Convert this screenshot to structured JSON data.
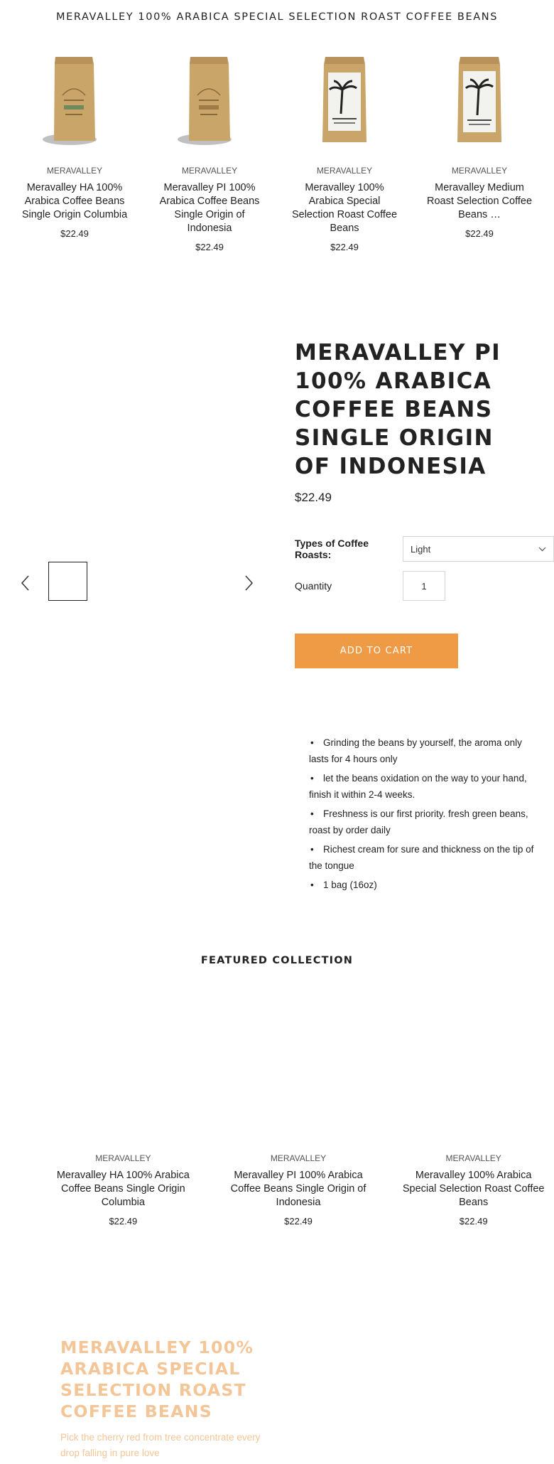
{
  "top_title": "MERAVALLEY 100% ARABICA SPECIAL SELECTION ROAST COFFEE BEANS",
  "related_products": [
    {
      "vendor": "MERAVALLEY",
      "title": "Meravalley HA 100% Arabica Coffee Beans Single Origin Columbia",
      "price": "$22.49",
      "image": "kraft-coffee-bag"
    },
    {
      "vendor": "MERAVALLEY",
      "title": "Meravalley PI 100% Arabica Coffee Beans Single Origin of Indonesia",
      "price": "$22.49",
      "image": "kraft-coffee-bag"
    },
    {
      "vendor": "MERAVALLEY",
      "title": "Meravalley 100% Arabica Special Selection Roast Coffee Beans",
      "price": "$22.49",
      "image": "palm-label-coffee-bag"
    },
    {
      "vendor": "MERAVALLEY",
      "title": "Meravalley Medium Roast Selection Coffee Beans …",
      "price": "$22.49",
      "image": "palm-label-coffee-bag"
    }
  ],
  "gallery": {
    "prev_icon": "chevron-left-icon",
    "next_icon": "chevron-right-icon"
  },
  "product": {
    "title": "MERAVALLEY PI 100% ARABICA COFFEE BEANS SINGLE ORIGIN OF INDONESIA",
    "price": "$22.49",
    "roast_label": "Types of Coffee Roasts:",
    "roast_value": "Light",
    "quantity_label": "Quantity",
    "quantity_value": "1",
    "add_to_cart": "ADD TO CART",
    "accent_color": "#ef9a45"
  },
  "features": [
    "Grinding the beans by yourself, the aroma only lasts for 4 hours only",
    "let the beans oxidation on the way to your hand, finish it within 2-4 weeks.",
    "Freshness is our first priority. fresh green beans, roast by order daily",
    "Richest cream for sure and thickness on the tip of the tongue",
    "1 bag (16oz)"
  ],
  "featured": {
    "heading": "FEATURED COLLECTION",
    "items": [
      {
        "vendor": "MERAVALLEY",
        "title": "Meravalley HA 100% Arabica Coffee Beans Single Origin Columbia",
        "price": "$22.49"
      },
      {
        "vendor": "MERAVALLEY",
        "title": "Meravalley PI 100% Arabica Coffee Beans Single Origin of Indonesia",
        "price": "$22.49"
      },
      {
        "vendor": "MERAVALLEY",
        "title": "Meravalley 100% Arabica Special Selection Roast Coffee Beans",
        "price": "$22.49"
      }
    ]
  },
  "promo": {
    "title": "MERAVALLEY 100% ARABICA SPECIAL SELECTION ROAST COFFEE BEANS",
    "text": "Pick the cherry red from tree concentrate every drop falling in pure love",
    "color": "#f4c596"
  }
}
